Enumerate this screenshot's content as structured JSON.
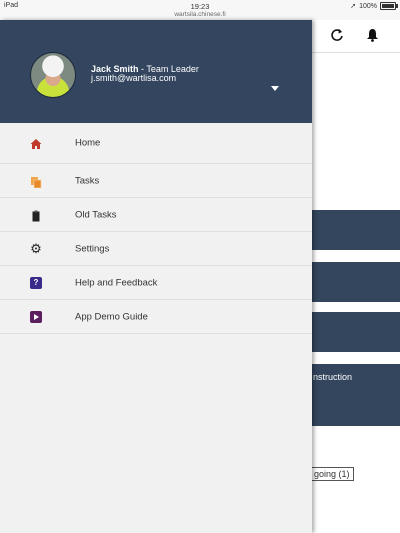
{
  "statusbar": {
    "carrier": "iPad",
    "time": "19:23",
    "url": "wartsila.chinese.fi",
    "battery": "100%"
  },
  "background": {
    "card_text": "nstruction",
    "ongoing_label": "going (1)"
  },
  "profile": {
    "name": "Jack Smith",
    "role": " - Team Leader",
    "email": "j.smith@wartlisa.com"
  },
  "menu": {
    "items": [
      {
        "label": "Home",
        "icon": "home-icon"
      },
      {
        "label": "Tasks",
        "icon": "tasks-icon"
      },
      {
        "label": "Old Tasks",
        "icon": "clipboard-icon"
      },
      {
        "label": "Settings",
        "icon": "gear-icon"
      },
      {
        "label": "Help and Feedback",
        "icon": "help-icon"
      },
      {
        "label": "App Demo Guide",
        "icon": "play-icon"
      }
    ]
  },
  "colors": {
    "header_bg": "#33455f",
    "drawer_bg": "#f1f1f1",
    "card_bg": "#34465e"
  }
}
